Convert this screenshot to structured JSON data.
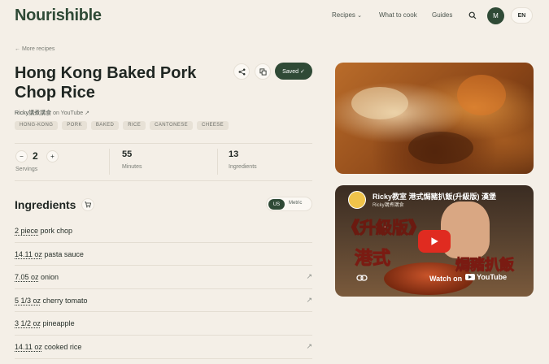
{
  "header": {
    "logo": "Nourishible",
    "nav": {
      "recipes": "Recipes",
      "recipes_chevron": "⌄",
      "what_to_cook": "What to cook",
      "guides": "Guides"
    },
    "avatar_initial": "M",
    "language": "EN"
  },
  "back_link": "← More recipes",
  "recipe": {
    "title": "Hong Kong Baked Pork Chop Rice",
    "source_channel": "Ricky講煮講食",
    "source_suffix": " on YouTube ↗",
    "saved_label": "Saved ✓",
    "tags": [
      "HONG-KONG",
      "PORK",
      "BAKED",
      "RICE",
      "CANTONESE",
      "CHEESE"
    ]
  },
  "stats": {
    "minus": "−",
    "plus": "+",
    "servings_value": "2",
    "servings_label": "Servings",
    "minutes_value": "55",
    "minutes_label": "Minutes",
    "ingredients_value": "13",
    "ingredients_label": "Ingredients"
  },
  "ingredients": {
    "heading": "Ingredients",
    "units": {
      "us": "US",
      "metric": "Metric",
      "selected": "US"
    },
    "items": [
      {
        "amount": "2 piece",
        "name": " pork chop",
        "has_link": false
      },
      {
        "amount": "14.11 oz",
        "name": " pasta sauce",
        "has_link": false
      },
      {
        "amount": "7.05 oz",
        "name": " onion",
        "has_link": true
      },
      {
        "amount": "5 1/3 oz",
        "name": " cherry tomato",
        "has_link": true
      },
      {
        "amount": "3 1/2 oz",
        "name": " pineapple",
        "has_link": false
      },
      {
        "amount": "14.11 oz",
        "name": " cooked rice",
        "has_link": true
      }
    ]
  },
  "video": {
    "title": "Ricky教室 港式焗豬扒飯(升級版) 漢堡",
    "channel": "Ricky講煮講食",
    "overlay_1": "《升級版》",
    "overlay_2": "港式",
    "overlay_3": "焗豬扒飯",
    "watch_on": "Watch on",
    "youtube": "YouTube"
  },
  "colors": {
    "brand": "#2f4a36",
    "background": "#f4efe7",
    "play": "#e02b20"
  }
}
